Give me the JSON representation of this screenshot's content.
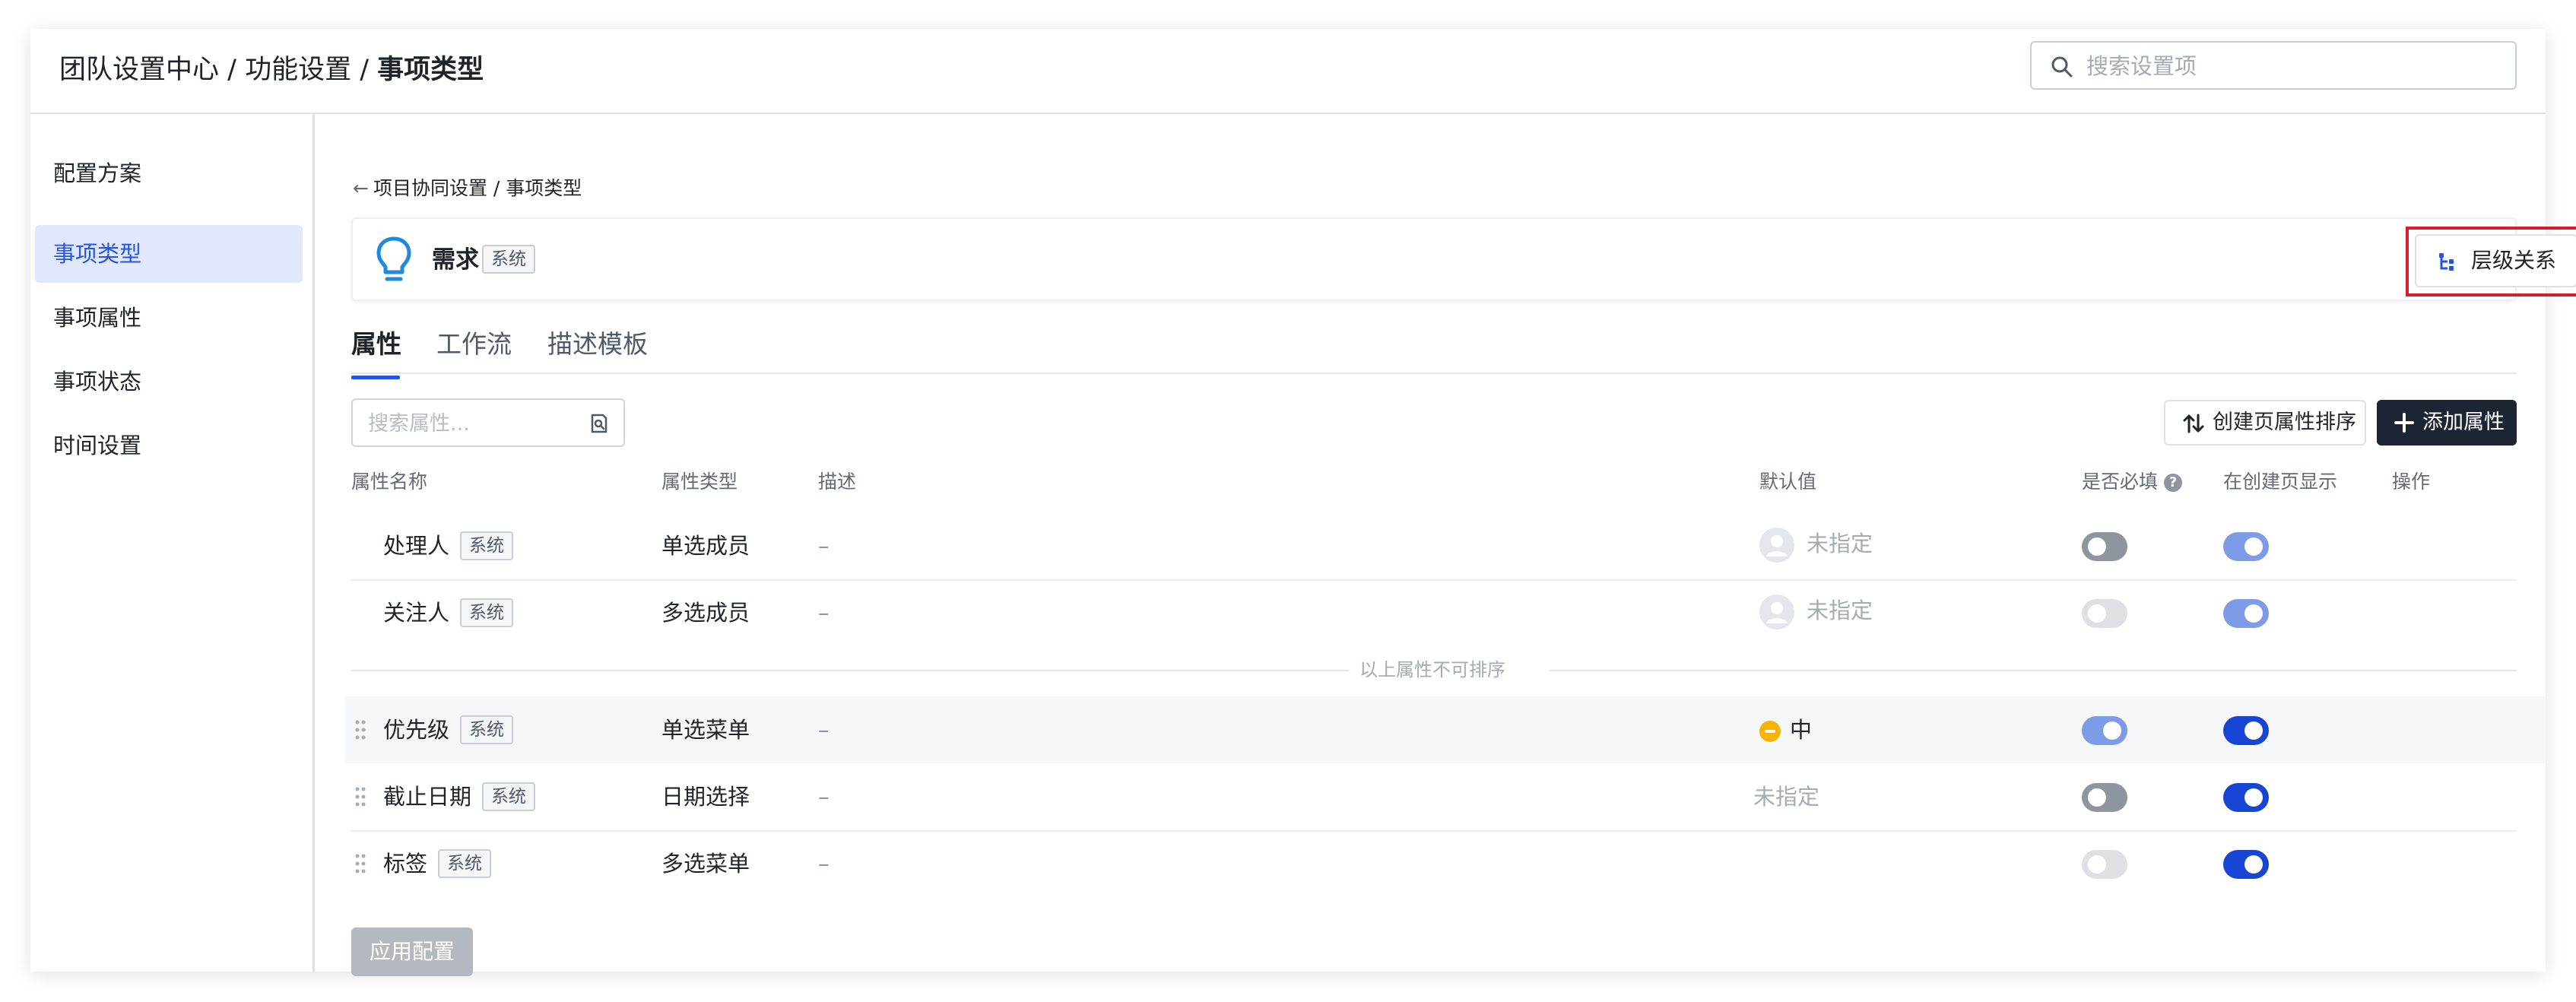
{
  "header": {
    "breadcrumb": [
      "团队设置中心",
      "功能设置",
      "事项类型"
    ],
    "separator": " / ",
    "search_placeholder": "搜索设置项"
  },
  "sidebar": {
    "items": [
      {
        "label": "配置方案",
        "active": false
      },
      {
        "label": "事项类型",
        "active": true
      },
      {
        "label": "事项属性",
        "active": false
      },
      {
        "label": "事项状态",
        "active": false
      },
      {
        "label": "时间设置",
        "active": false
      }
    ]
  },
  "main": {
    "back_link": "项目协同设置 / 事项类型",
    "type_card": {
      "name": "需求",
      "tag": "系统",
      "hierarchy_button": "层级关系"
    },
    "tabs": [
      {
        "label": "属性",
        "active": true
      },
      {
        "label": "工作流",
        "active": false
      },
      {
        "label": "描述模板",
        "active": false
      }
    ],
    "attr_search_placeholder": "搜索属性...",
    "sort_button": "创建页属性排序",
    "add_button": "添加属性",
    "table": {
      "headers": {
        "name": "属性名称",
        "type": "属性类型",
        "desc": "描述",
        "default": "默认值",
        "required": "是否必填",
        "show_on_create": "在创建页显示",
        "actions": "操作"
      },
      "fixed_rows": [
        {
          "name": "处理人",
          "tag": "系统",
          "type": "单选成员",
          "desc": "–",
          "default": "未指定",
          "required": false,
          "required_disabled": false,
          "show": true,
          "show_disabled": true
        },
        {
          "name": "关注人",
          "tag": "系统",
          "type": "多选成员",
          "desc": "–",
          "default": "未指定",
          "required": false,
          "required_disabled": true,
          "show": true,
          "show_disabled": true
        }
      ],
      "divider_text": "以上属性不可排序",
      "sortable_rows": [
        {
          "name": "优先级",
          "tag": "系统",
          "type": "单选菜单",
          "desc": "–",
          "default": "中",
          "required": true,
          "show": true
        },
        {
          "name": "截止日期",
          "tag": "系统",
          "type": "日期选择",
          "desc": "–",
          "default": "未指定",
          "required": false,
          "show": true
        },
        {
          "name": "标签",
          "tag": "系统",
          "type": "多选菜单",
          "desc": "–",
          "default": "",
          "required": false,
          "required_disabled": true,
          "show": true
        }
      ]
    },
    "apply_button": "应用配置"
  },
  "colors": {
    "accent": "#2454e6",
    "toggle_on": "#1645d6",
    "toggle_on_light": "#7e9be8",
    "highlight_border": "#d81c2a",
    "priority_medium": "#f5b400"
  }
}
